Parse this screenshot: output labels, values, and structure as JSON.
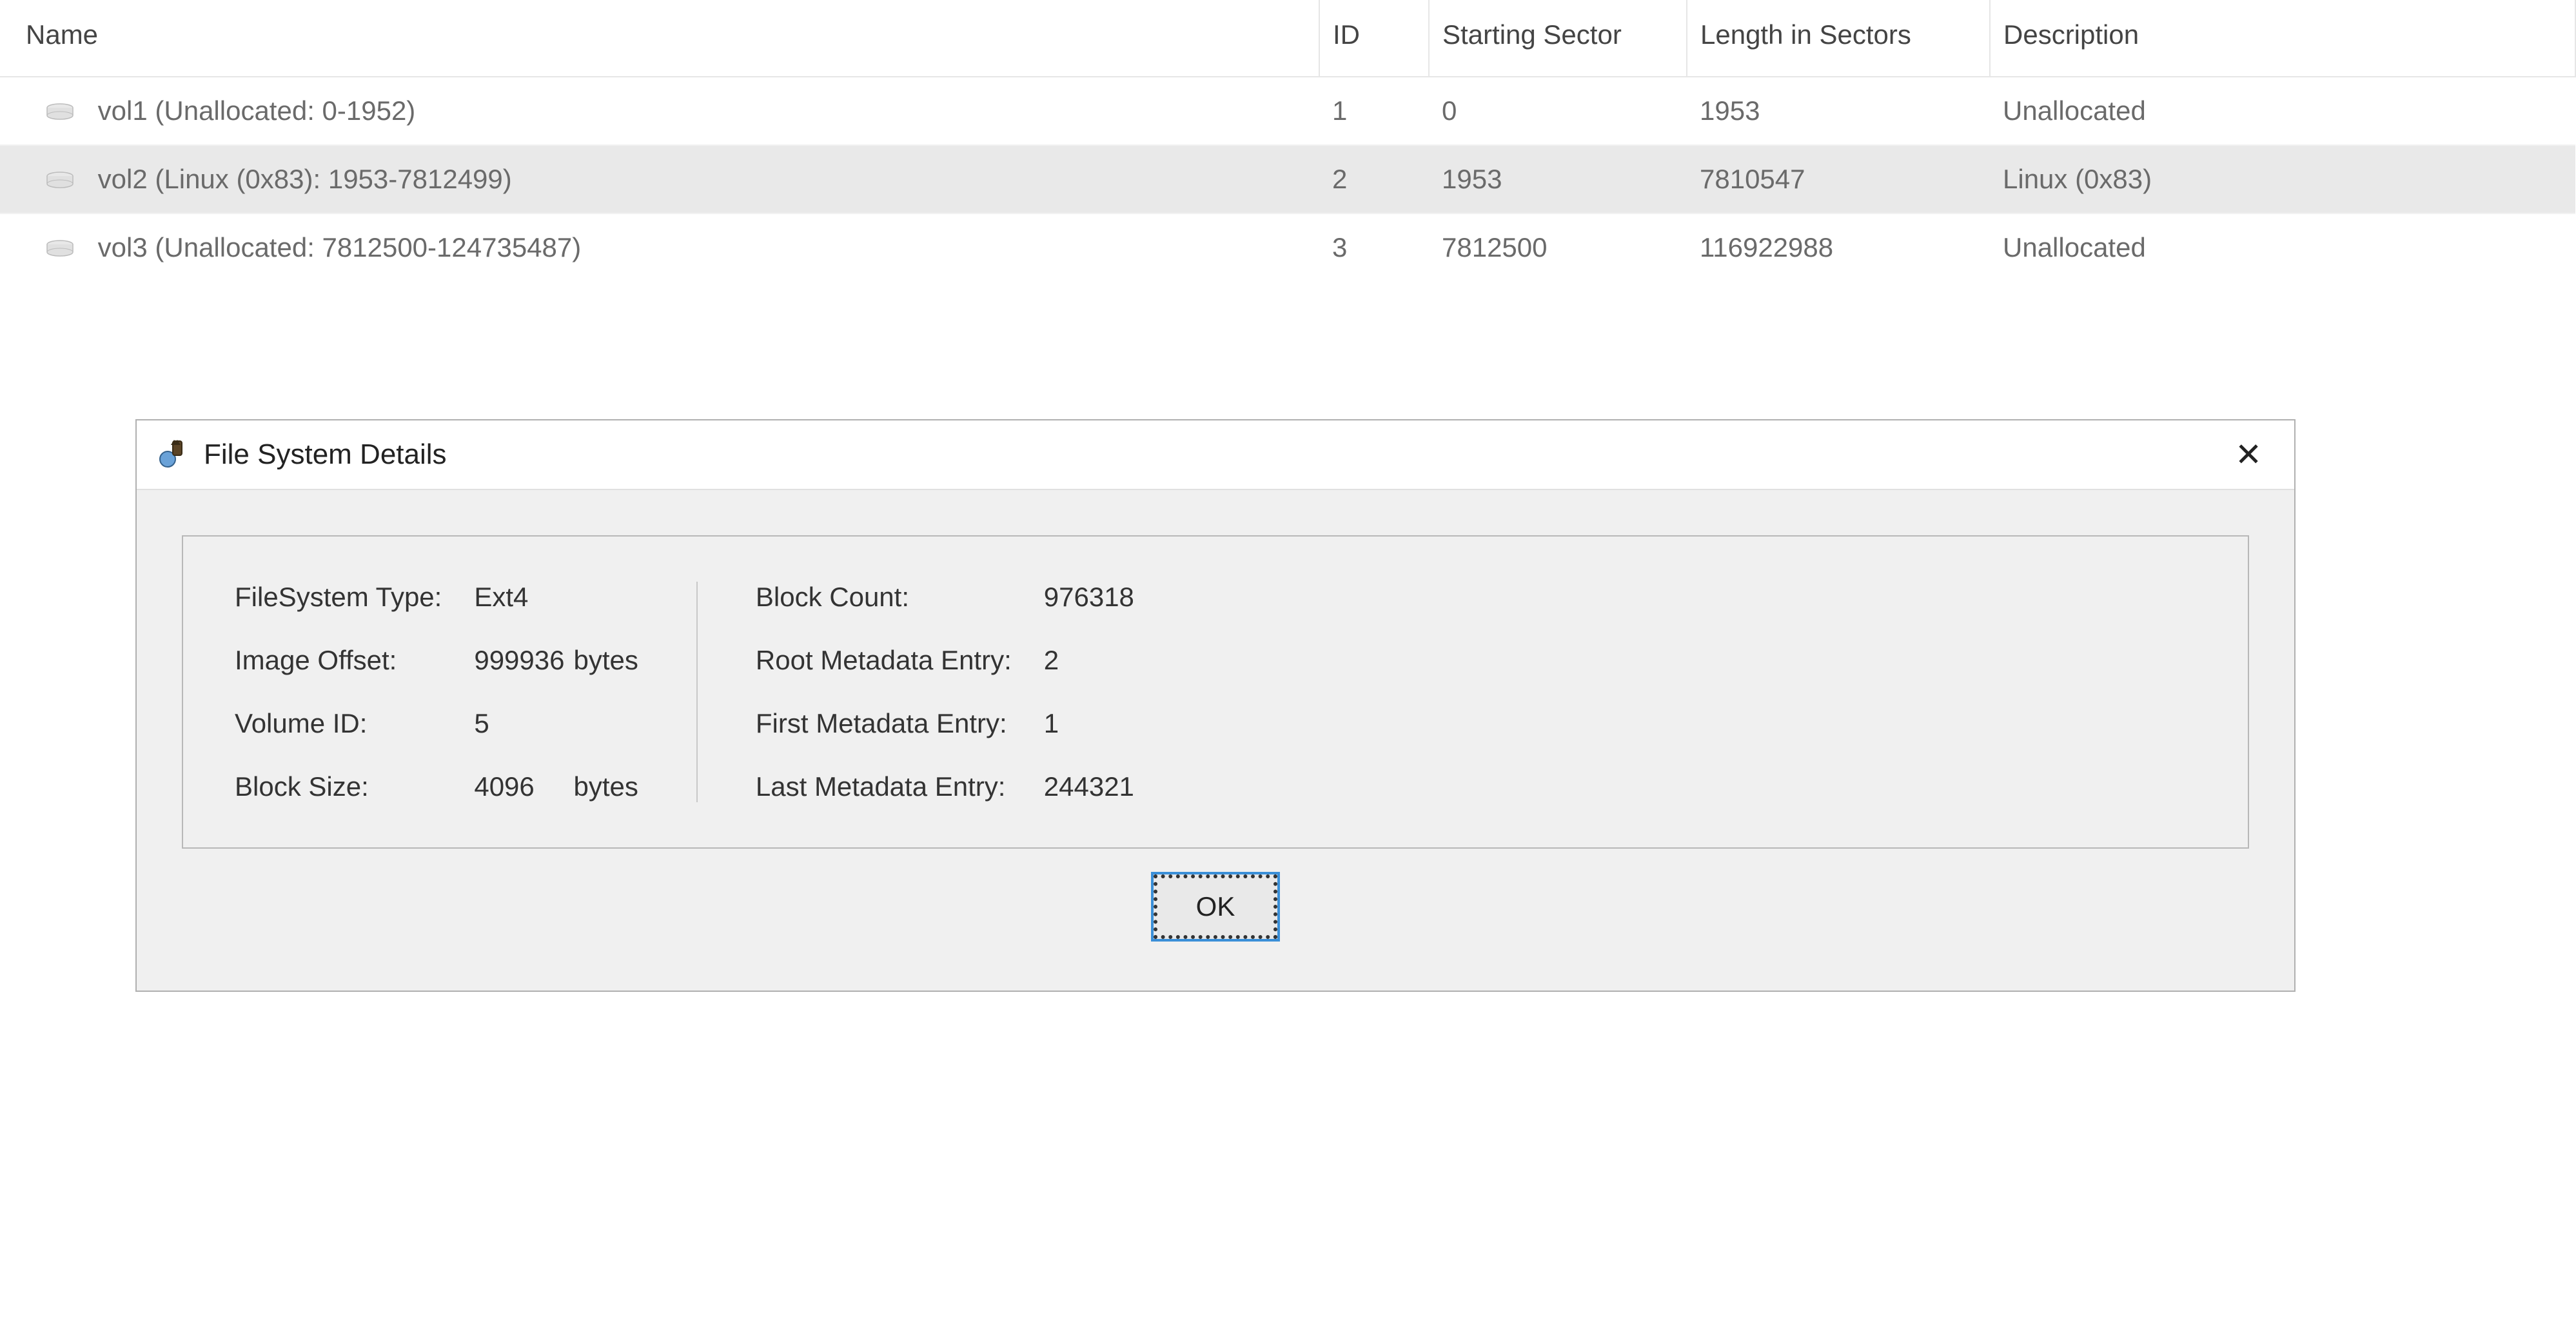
{
  "table": {
    "headers": {
      "name": "Name",
      "id": "ID",
      "start": "Starting Sector",
      "length": "Length in Sectors",
      "desc": "Description"
    },
    "rows": [
      {
        "name": "vol1 (Unallocated: 0-1952)",
        "id": "1",
        "start": "0",
        "length": "1953",
        "desc": "Unallocated",
        "selected": false
      },
      {
        "name": "vol2 (Linux (0x83): 1953-7812499)",
        "id": "2",
        "start": "1953",
        "length": "7810547",
        "desc": "Linux (0x83)",
        "selected": true
      },
      {
        "name": "vol3 (Unallocated: 7812500-124735487)",
        "id": "3",
        "start": "7812500",
        "length": "116922988",
        "desc": "Unallocated",
        "selected": false
      }
    ]
  },
  "dialog": {
    "title": "File System Details",
    "left": [
      {
        "label": "FileSystem Type:",
        "value": "Ext4",
        "unit": ""
      },
      {
        "label": "Image Offset:",
        "value": "999936",
        "unit": "bytes"
      },
      {
        "label": "Volume ID:",
        "value": "5",
        "unit": ""
      },
      {
        "label": "Block Size:",
        "value": "4096",
        "unit": "bytes"
      }
    ],
    "right": [
      {
        "label": "Block Count:",
        "value": "976318"
      },
      {
        "label": "Root Metadata Entry:",
        "value": "2"
      },
      {
        "label": "First Metadata Entry:",
        "value": "1"
      },
      {
        "label": "Last Metadata Entry:",
        "value": "244321"
      }
    ],
    "ok": "OK"
  }
}
